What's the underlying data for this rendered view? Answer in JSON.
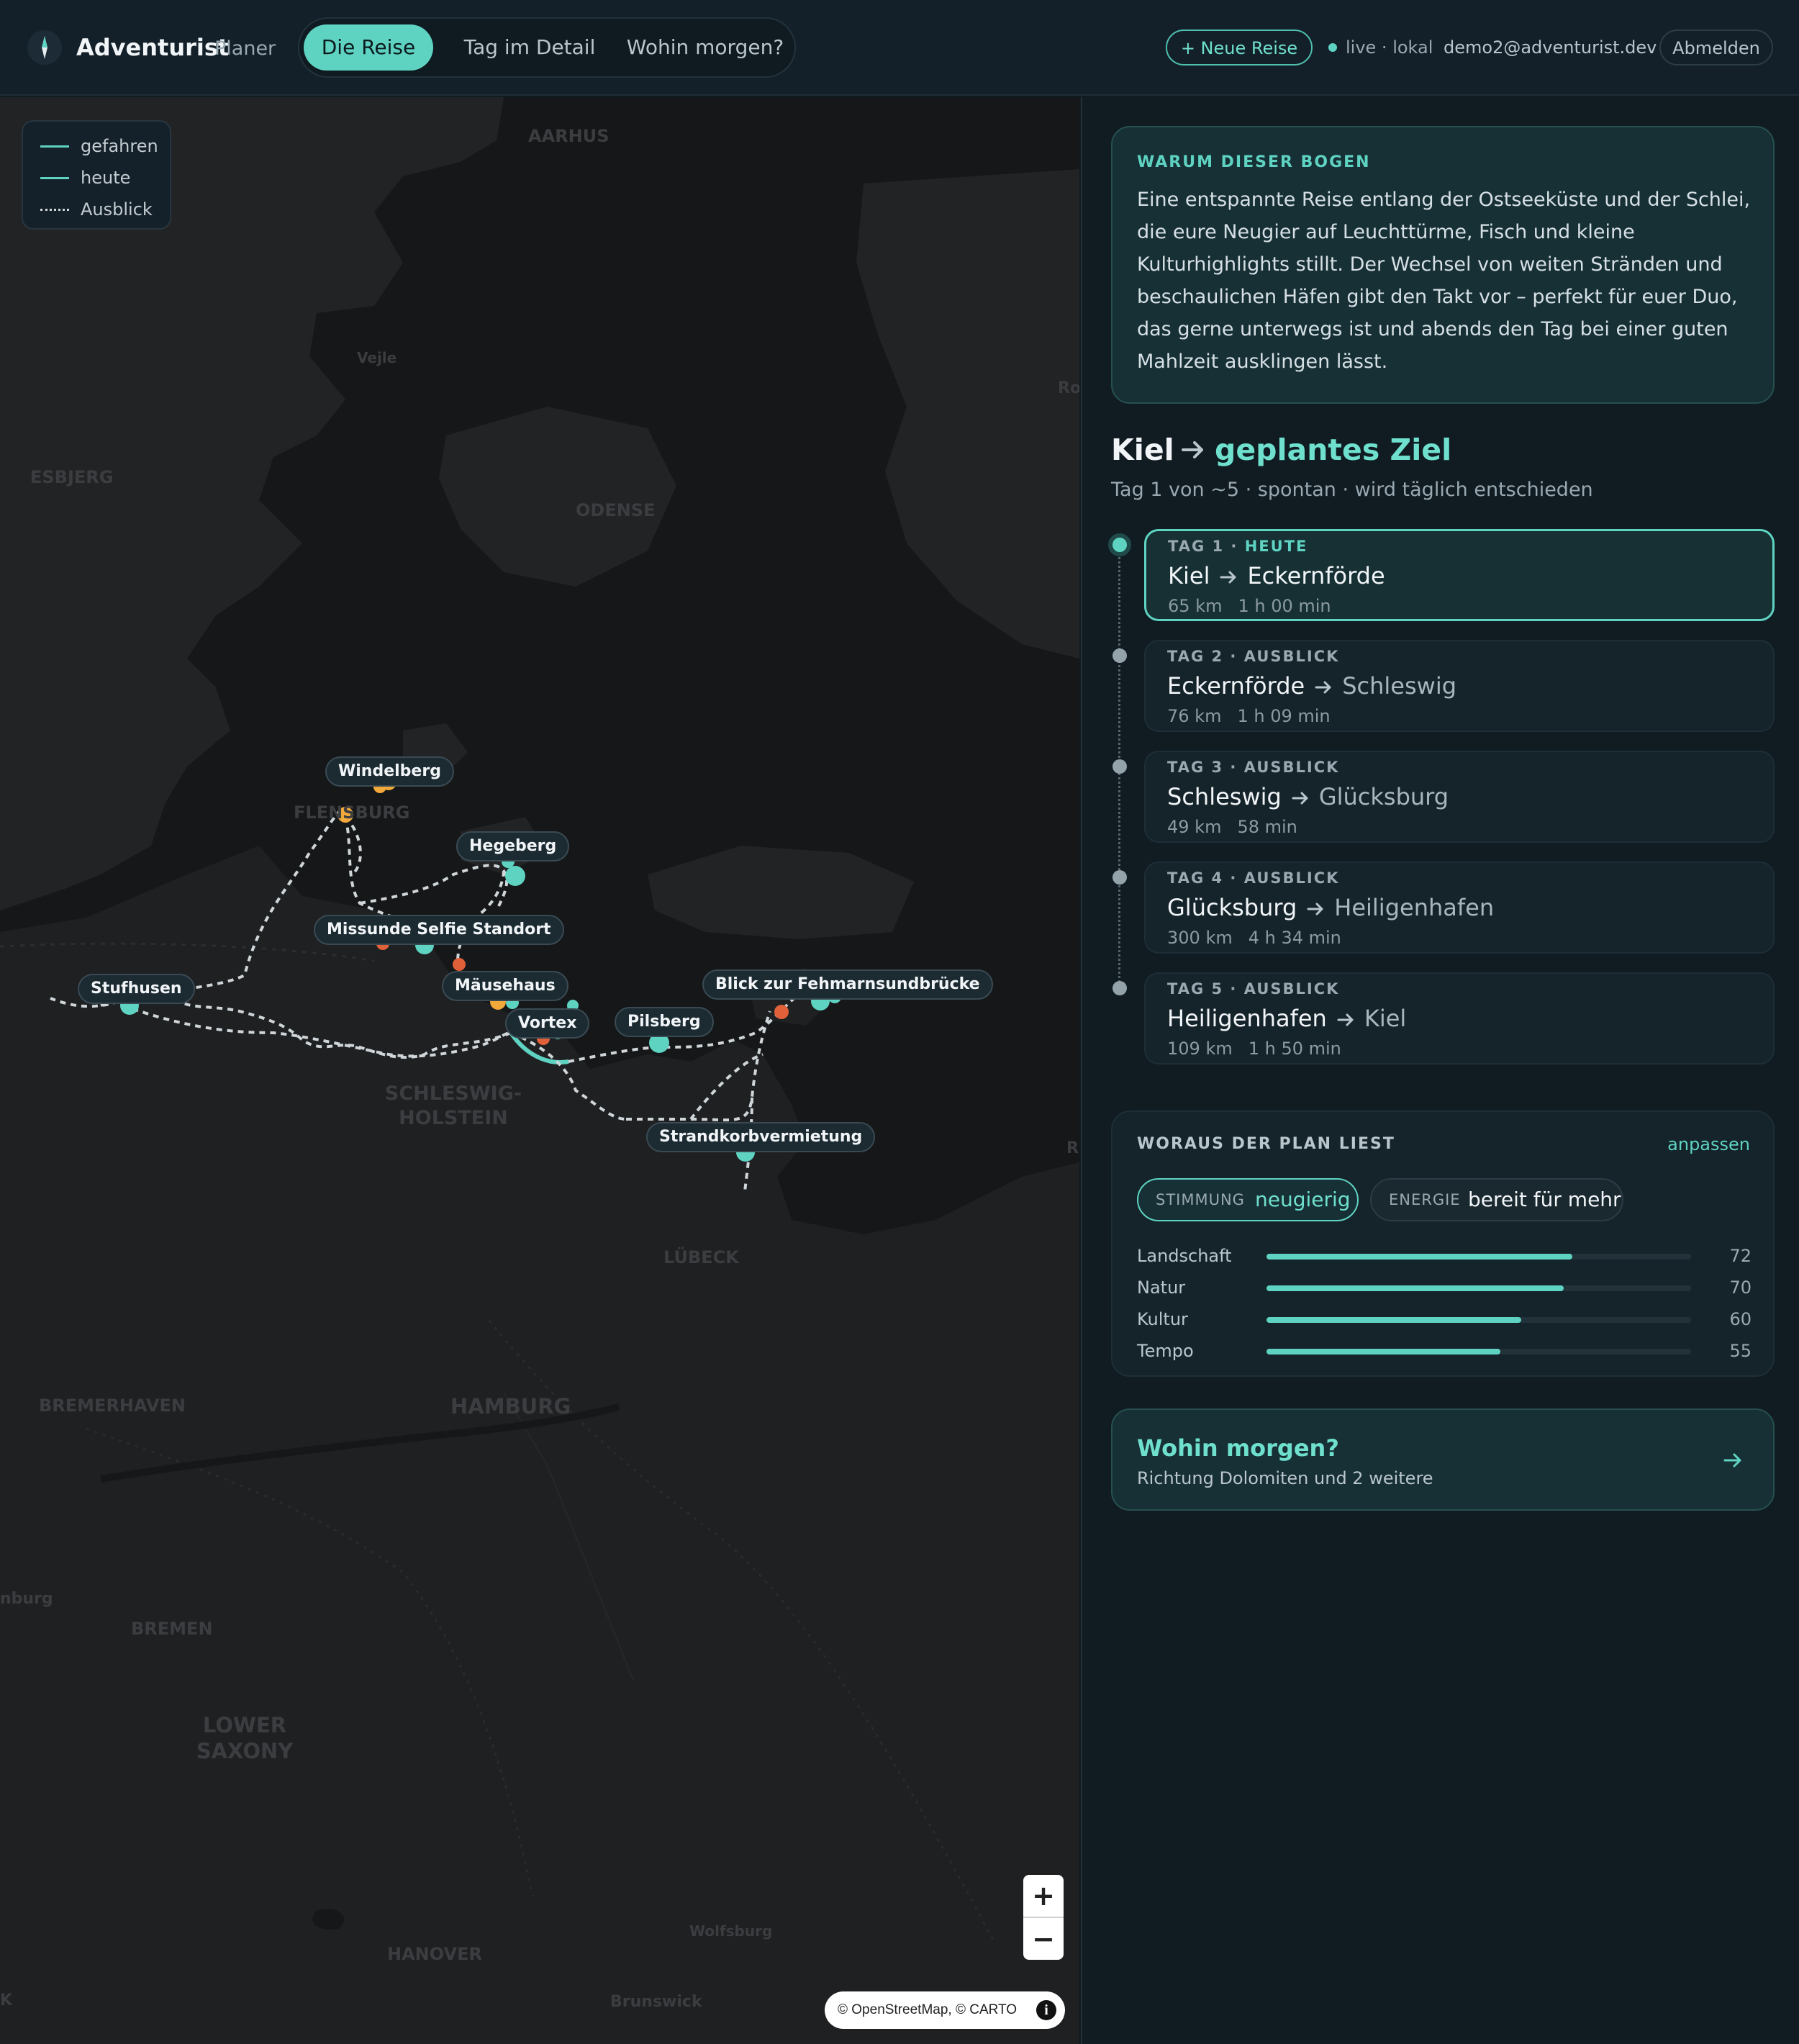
{
  "header": {
    "brand": "Adventurist",
    "brand_sub": "Planer",
    "tabs": [
      {
        "label": "Die Reise",
        "active": true
      },
      {
        "label": "Tag im Detail",
        "active": false
      },
      {
        "label": "Wohin morgen?",
        "active": false
      }
    ],
    "new_trip_label": "+ Neue Reise",
    "status_text": "live · lokal",
    "user_email": "demo2@adventurist.dev",
    "logout_label": "Abmelden"
  },
  "map": {
    "legend": [
      {
        "label": "gefahren",
        "style": "solid"
      },
      {
        "label": "heute",
        "style": "solid"
      },
      {
        "label": "Ausblick",
        "style": "dotted"
      }
    ],
    "place_labels": {
      "aarhus": "AARHUS",
      "vejle": "Vejle",
      "esbjerg": "ESBJERG",
      "odense": "ODENSE",
      "flensburg": "FLENSBURG",
      "schleswig_holstein": "SCHLESWIG-",
      "schleswig_holstein_2": "HOLSTEIN",
      "luebeck": "LÜBECK",
      "bremerhaven": "BREMERHAVEN",
      "hamburg": "HAMBURG",
      "bremen": "BREMEN",
      "lower_saxony": "LOWER",
      "lower_saxony_2": "SAXONY",
      "hanover": "HANOVER",
      "wolfsburg": "Wolfsburg",
      "brunswick": "Brunswick",
      "ro": "Ro",
      "ri": "R",
      "nburg": "nburg",
      "k": "K"
    },
    "pois": [
      {
        "label": "Windelberg"
      },
      {
        "label": "Hegeberg"
      },
      {
        "label": "Missunde Selfie Standort"
      },
      {
        "label": "Stufhusen"
      },
      {
        "label": "Mäusehaus"
      },
      {
        "label": "Vortex"
      },
      {
        "label": "Pilsberg"
      },
      {
        "label": "Blick zur Fehmarnsundbrücke"
      },
      {
        "label": "Strandkorbvermietung"
      }
    ],
    "zoom_in": "+",
    "zoom_out": "−",
    "attribution": "© OpenStreetMap, © CARTO",
    "info_glyph": "i",
    "colors": {
      "route": "#5fd3c2",
      "poi_orange": "#f0a93a",
      "poi_red": "#e0603a",
      "outlook": "#cfd6da"
    }
  },
  "why": {
    "label": "WARUM DIESER BOGEN",
    "text": "Eine entspannte Reise entlang der Ostseeküste und der Schlei, die eure Neugier auf Leuchttürme, Fisch und kleine Kulturhighlights stillt. Der Wechsel von weiten Stränden und beschaulichen Häfen gibt den Takt vor – perfekt für euer Duo, das gerne unterwegs ist und abends den Tag bei einer guten Mahlzeit ausklingen lässt."
  },
  "trip": {
    "from": "Kiel",
    "to": "geplantes Ziel",
    "subtitle": "Tag 1 von ~5 · spontan · wird täglich entschieden"
  },
  "days": [
    {
      "tag": "TAG 1",
      "status": "HEUTE",
      "from": "Kiel",
      "to": "Eckernförde",
      "km": "65 km",
      "time": "1 h 00 min",
      "active": true
    },
    {
      "tag": "TAG 2",
      "status": "AUSBLICK",
      "from": "Eckernförde",
      "to": "Schleswig",
      "km": "76 km",
      "time": "1 h 09 min",
      "active": false
    },
    {
      "tag": "TAG 3",
      "status": "AUSBLICK",
      "from": "Schleswig",
      "to": "Glücksburg",
      "km": "49 km",
      "time": "58 min",
      "active": false
    },
    {
      "tag": "TAG 4",
      "status": "AUSBLICK",
      "from": "Glücksburg",
      "to": "Heiligenhafen",
      "km": "300 km",
      "time": "4 h 34 min",
      "active": false
    },
    {
      "tag": "TAG 5",
      "status": "AUSBLICK",
      "from": "Heiligenhafen",
      "to": "Kiel",
      "km": "109 km",
      "time": "1 h 50 min",
      "active": false
    }
  ],
  "plan": {
    "label": "WORAUS DER PLAN LIEST",
    "edit_label": "anpassen",
    "mood_key": "STIMMUNG",
    "mood_value": "neugierig",
    "energy_key": "ENERGIE",
    "energy_value": "bereit für mehr",
    "stats": [
      {
        "label": "Landschaft",
        "value": 72
      },
      {
        "label": "Natur",
        "value": 70
      },
      {
        "label": "Kultur",
        "value": 60
      },
      {
        "label": "Tempo",
        "value": 55
      }
    ]
  },
  "next": {
    "title": "Wohin morgen?",
    "subtitle": "Richtung Dolomiten und 2 weitere"
  }
}
